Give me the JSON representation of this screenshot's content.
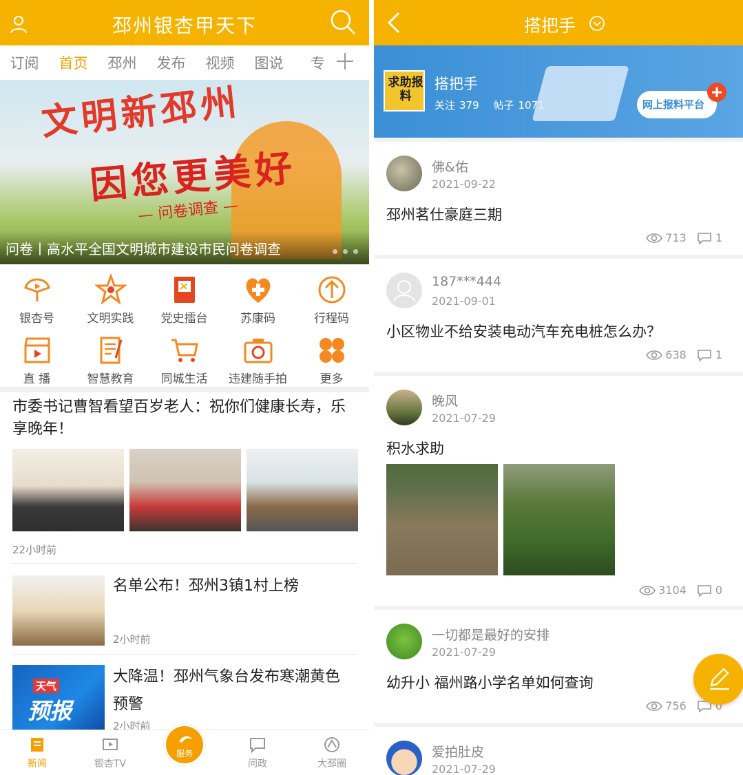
{
  "left": {
    "header": {
      "title": "邳州银杏甲天下"
    },
    "tabs": [
      "订阅",
      "首页",
      "邳州",
      "发布",
      "视频",
      "图说",
      "专"
    ],
    "active_tab": "首页",
    "banner": {
      "line1": "文明新邳州",
      "line2": "因您更美好",
      "line3": "— 问卷调查 —",
      "caption": "问卷丨高水平全国文明城市建设市民问卷调查"
    },
    "grid": [
      {
        "label": "银杏号",
        "icon": "ginkgo-icon"
      },
      {
        "label": "文明实践",
        "icon": "star-emblem-icon"
      },
      {
        "label": "党史擂台",
        "icon": "party-book-icon"
      },
      {
        "label": "苏康码",
        "icon": "heart-plus-icon"
      },
      {
        "label": "行程码",
        "icon": "arrow-up-circle-icon"
      },
      {
        "label": "直 播",
        "icon": "clapper-icon"
      },
      {
        "label": "智慧教育",
        "icon": "notebook-icon"
      },
      {
        "label": "同城生活",
        "icon": "cart-icon"
      },
      {
        "label": "违建随手拍",
        "icon": "camera-icon"
      },
      {
        "label": "更多",
        "icon": "four-petal-icon"
      }
    ],
    "news": [
      {
        "title": "市委书记曹智看望百岁老人：祝你们健康长寿，乐享晚年！",
        "time": "22小时前"
      },
      {
        "title": "名单公布！邳州3镇1村上榜",
        "time": "2小时前"
      },
      {
        "title": "大降温！邳州气象台发布寒潮黄色预警",
        "time": "2小时前",
        "thumb_text_1": "天气",
        "thumb_text_2": "预报"
      }
    ],
    "bottom_nav": [
      {
        "label": "新闻",
        "icon": "news-icon",
        "active": true
      },
      {
        "label": "银杏TV",
        "icon": "tv-icon",
        "active": false
      },
      {
        "label": "服务",
        "icon": "service-icon",
        "active": false
      },
      {
        "label": "问政",
        "icon": "chat-icon",
        "active": false
      },
      {
        "label": "大邳圈",
        "icon": "circle-icon",
        "active": false
      }
    ],
    "colors": {
      "brand": "#f5b300",
      "accent": "#f5a000"
    }
  },
  "right": {
    "header": {
      "title": "搭把手"
    },
    "banner": {
      "logo_text": "求助报料",
      "name": "搭把手",
      "follow_label": "关注",
      "follow_count": "379",
      "posts_label": "帖子",
      "posts_count": "1071",
      "cloud_text": "网上报料平台"
    },
    "posts": [
      {
        "user": "佛&佑",
        "date": "2021-09-22",
        "title": "邳州茗仕豪庭三期",
        "views": "713",
        "comments": "1"
      },
      {
        "user": "187***444",
        "date": "2021-09-01",
        "title": "小区物业不给安装电动汽车充电桩怎么办？",
        "views": "638",
        "comments": "1"
      },
      {
        "user": "晚风",
        "date": "2021-07-29",
        "title": "积水求助",
        "views": "3104",
        "comments": "0"
      },
      {
        "user": "一切都是最好的安排",
        "date": "2021-07-29",
        "title": "幼升小 福州路小学名单如何查询",
        "views": "756",
        "comments": "0"
      },
      {
        "user": "爱拍肚皮",
        "date": "2021-07-29"
      }
    ]
  }
}
